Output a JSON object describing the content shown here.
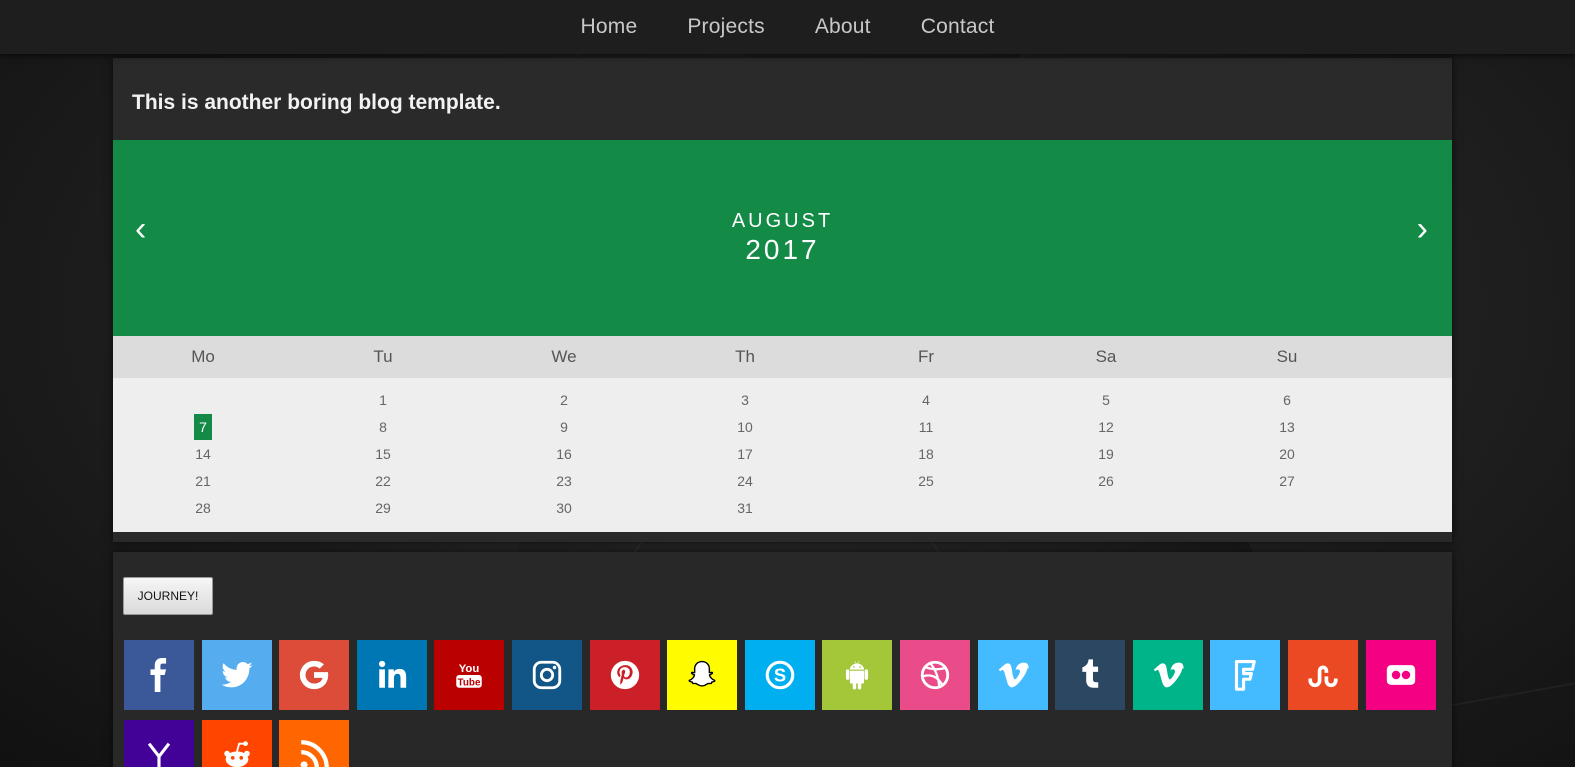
{
  "nav": {
    "items": [
      {
        "label": "Home"
      },
      {
        "label": "Projects"
      },
      {
        "label": "About"
      },
      {
        "label": "Contact"
      }
    ]
  },
  "blog": {
    "title": "This is another boring blog template."
  },
  "calendar": {
    "prev": "‹",
    "next": "›",
    "month": "AUGUST",
    "year": "2017",
    "day_names": [
      "Mo",
      "Tu",
      "We",
      "Th",
      "Fr",
      "Sa",
      "Su"
    ],
    "today": 7,
    "weeks": [
      [
        "",
        "1",
        "2",
        "3",
        "4",
        "5",
        "6"
      ],
      [
        "7",
        "8",
        "9",
        "10",
        "11",
        "12",
        "13"
      ],
      [
        "14",
        "15",
        "16",
        "17",
        "18",
        "19",
        "20"
      ],
      [
        "21",
        "22",
        "23",
        "24",
        "25",
        "26",
        "27"
      ],
      [
        "28",
        "29",
        "30",
        "31",
        "",
        "",
        ""
      ]
    ],
    "accent": "#138a46"
  },
  "journey_button": "JOURNEY!",
  "social": [
    {
      "name": "facebook-icon",
      "color": "#3b5998",
      "glyph": "f"
    },
    {
      "name": "twitter-icon",
      "color": "#55acee",
      "glyph": "bird"
    },
    {
      "name": "google-icon",
      "color": "#dd4b39",
      "glyph": "G"
    },
    {
      "name": "linkedin-icon",
      "color": "#0077b5",
      "glyph": "in"
    },
    {
      "name": "youtube-icon",
      "color": "#bb0000",
      "glyph": "YouTube"
    },
    {
      "name": "instagram-icon",
      "color": "#125688",
      "glyph": "camera"
    },
    {
      "name": "pinterest-icon",
      "color": "#cb2027",
      "glyph": "p"
    },
    {
      "name": "snapchat-icon",
      "color": "#fffc00",
      "glyph": "ghost"
    },
    {
      "name": "skype-icon",
      "color": "#00aff0",
      "glyph": "S"
    },
    {
      "name": "android-icon",
      "color": "#a4c639",
      "glyph": "droid"
    },
    {
      "name": "dribbble-icon",
      "color": "#ea4c89",
      "glyph": "ball"
    },
    {
      "name": "vimeo-icon",
      "color": "#45bbff",
      "glyph": "v"
    },
    {
      "name": "tumblr-icon",
      "color": "#2c4762",
      "glyph": "t"
    },
    {
      "name": "vine-icon",
      "color": "#00b489",
      "glyph": "v"
    },
    {
      "name": "foursquare-icon",
      "color": "#45bbff",
      "glyph": "F"
    },
    {
      "name": "stumbleupon-icon",
      "color": "#eb4924",
      "glyph": "su"
    },
    {
      "name": "flickr-icon",
      "color": "#f40083",
      "glyph": "dots"
    },
    {
      "name": "yahoo-icon",
      "color": "#430297",
      "glyph": "Y"
    },
    {
      "name": "reddit-icon",
      "color": "#ff4500",
      "glyph": "alien"
    },
    {
      "name": "rss-icon",
      "color": "#ff6600",
      "glyph": "rss"
    }
  ]
}
